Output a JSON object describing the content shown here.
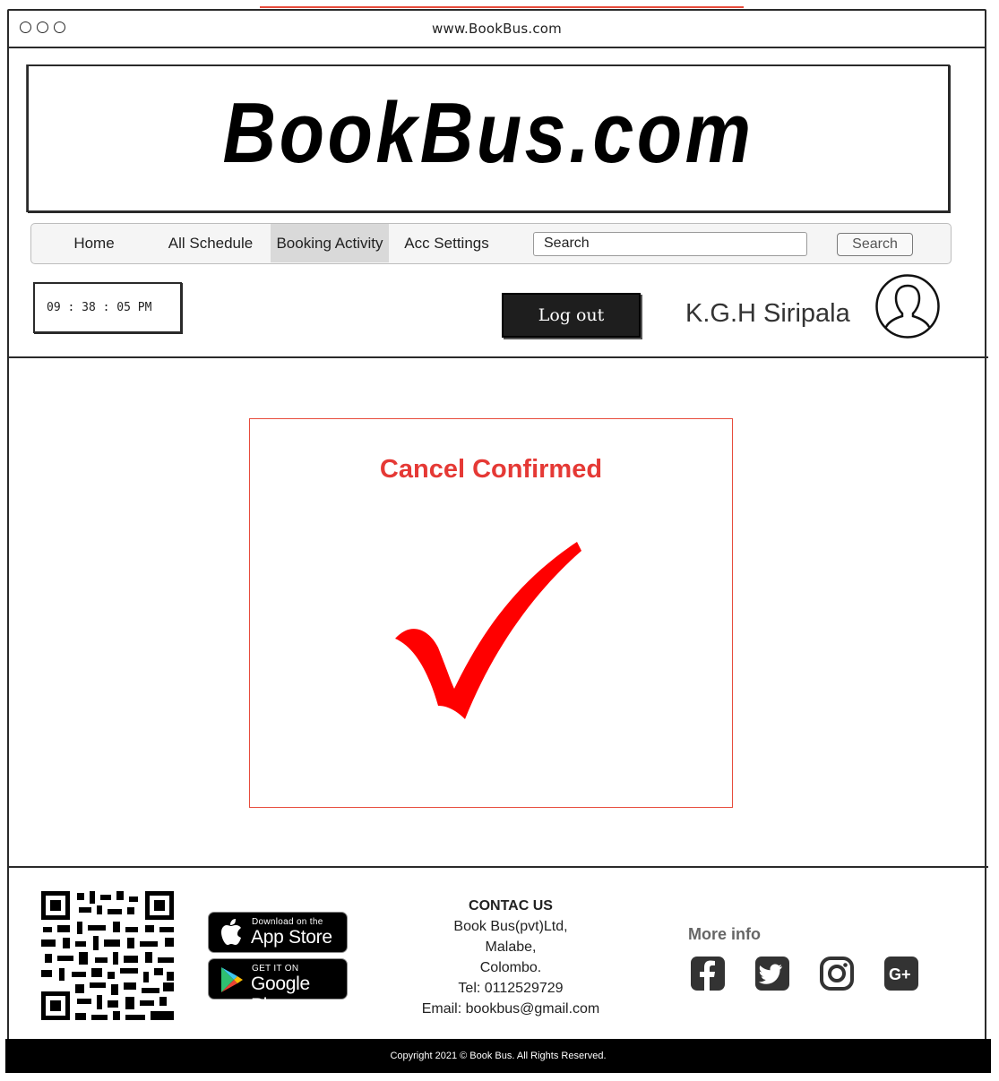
{
  "browser": {
    "url": "www.BookBus.com"
  },
  "header": {
    "logo_text": "BookBus.com"
  },
  "nav": {
    "items": [
      {
        "label": "Home",
        "active": false
      },
      {
        "label": "All Schedule",
        "active": false
      },
      {
        "label": "Booking Activity",
        "active": true
      },
      {
        "label": "Acc Settings",
        "active": false
      }
    ],
    "search_value": "Search",
    "search_button": "Search"
  },
  "status": {
    "clock": "09 : 38 : 05 PM",
    "logout_label": "Log out",
    "user_name": "K.G.H Siripala"
  },
  "main": {
    "confirm_title": "Cancel Confirmed",
    "check_color": "#ff0000",
    "title_color": "#e53935"
  },
  "footer": {
    "app_store": {
      "small": "Download on the",
      "big": "App Store"
    },
    "google_play": {
      "small": "GET IT ON",
      "big": "Google Play"
    },
    "contact": {
      "title": "CONTAC US",
      "lines": [
        "Book Bus(pvt)Ltd,",
        "Malabe,",
        "Colombo.",
        "Tel: 0112529729",
        "Email: bookbus@gmail.com"
      ]
    },
    "more_info": "More info",
    "social_icons": [
      "facebook-icon",
      "twitter-icon",
      "instagram-icon",
      "google-plus-icon"
    ],
    "copyright": "Copyright 2021 © Book Bus. All Rights Reserved."
  }
}
